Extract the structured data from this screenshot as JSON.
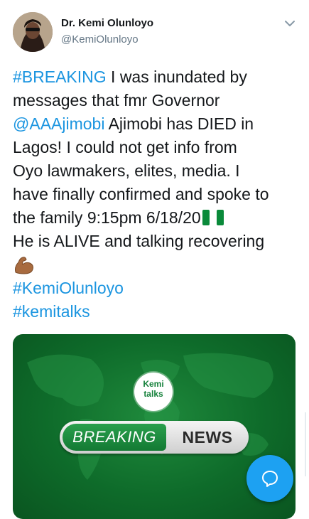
{
  "author": {
    "display_name": "Dr. Kemi Olunloyo",
    "handle": "@KemiOlunloyo"
  },
  "tweet": {
    "hashtag_breaking": "#BREAKING",
    "line1_rest": " I was inundated by",
    "line2": "messages that fmr Governor",
    "mention": "@AAAjimobi",
    "line3_rest": " Ajimobi has DIED in",
    "line4": "Lagos! I could not get info from",
    "line5": "Oyo lawmakers, elites, media. I",
    "line6": "have finally confirmed and spoke to",
    "line7": "the family 9:15pm 6/18/20",
    "line8": "He is ALIVE and talking recovering",
    "hashtag_name": "#KemiOlunloyo",
    "hashtag_talks": "#kemitalks",
    "emoji_flag": "nigeria-flag-icon",
    "emoji_bicep": "flexed-biceps-icon"
  },
  "media": {
    "logo_top": "Kemi",
    "logo_bottom": "talks",
    "banner_left": "BREAKING",
    "banner_right": "NEWS"
  },
  "colors": {
    "link": "#1b95e0",
    "fab": "#1da1f2",
    "media_green": "#137a33"
  }
}
